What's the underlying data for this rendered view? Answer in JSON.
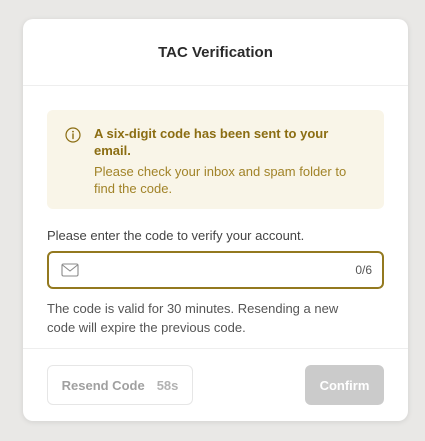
{
  "dialog": {
    "title": "TAC Verification"
  },
  "alert": {
    "icon": "info-icon",
    "title": "A six-digit code has been sent to your email.",
    "description": "Please check your inbox and spam folder to find the code.",
    "color": "#8b6d12",
    "background": "#f9f5e8"
  },
  "prompt": "Please enter the code to verify your account.",
  "code_input": {
    "icon": "mail-icon",
    "value": "",
    "placeholder": "",
    "counter": "0/6",
    "border_color": "#93791f"
  },
  "note": "The code is valid for 30 minutes. Resending a new code will expire the previous code.",
  "footer": {
    "resend_label": "Resend Code",
    "resend_timer": "58s",
    "confirm_label": "Confirm",
    "confirm_color": "#cbcbcb"
  }
}
